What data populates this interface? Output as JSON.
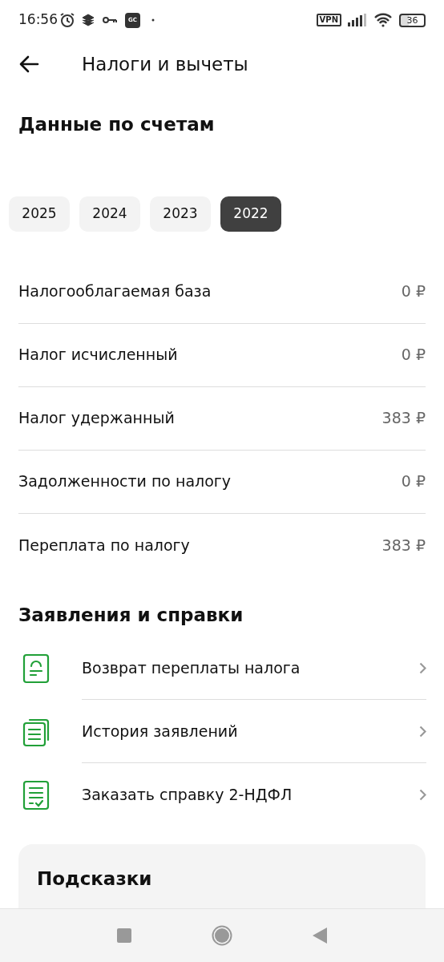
{
  "status_bar": {
    "time": "16:56",
    "app_badge": "GC",
    "vpn": "VPN",
    "battery": "36"
  },
  "header": {
    "title": "Налоги и вычеты"
  },
  "accounts": {
    "title": "Данные по счетам",
    "years": [
      {
        "label": "2025",
        "selected": false
      },
      {
        "label": "2024",
        "selected": false
      },
      {
        "label": "2023",
        "selected": false
      },
      {
        "label": "2022",
        "selected": true
      }
    ]
  },
  "rows": [
    {
      "label": "Налогооблагаемая база",
      "value": "0 ₽"
    },
    {
      "label": "Налог исчисленный",
      "value": "0 ₽"
    },
    {
      "label": "Налог удержанный",
      "value": "383 ₽"
    },
    {
      "label": "Задолженности по налогу",
      "value": "0 ₽"
    },
    {
      "label": "Переплата по налогу",
      "value": "383 ₽"
    }
  ],
  "statements": {
    "title": "Заявления и справки",
    "items": [
      {
        "kind": "refund",
        "label": "Возврат переплаты налога"
      },
      {
        "kind": "history",
        "label": "История заявлений"
      },
      {
        "kind": "certificate",
        "label": "Заказать справку 2-НДФЛ"
      }
    ]
  },
  "tips": {
    "title": "Подсказки"
  }
}
